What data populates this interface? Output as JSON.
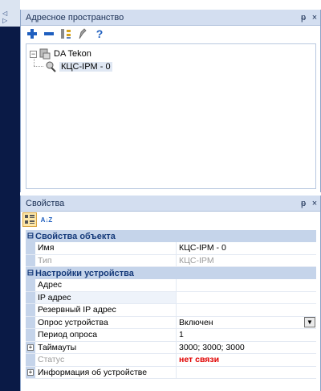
{
  "colors": {
    "accent": "#1f5fbf",
    "error": "#e00000"
  },
  "address_panel": {
    "title": "Адресное пространство",
    "pin": "ᵽ",
    "close": "×",
    "toolbar": {
      "add_icon": "plus-icon",
      "remove_icon": "minus-icon",
      "tool_icon": "settings-icon",
      "edit_icon": "pen-icon",
      "help_label": "?"
    },
    "tree": {
      "root_label": "DA Tekon",
      "child_label": "КЦС-IPM - 0"
    }
  },
  "properties_panel": {
    "title": "Свойства",
    "pin": "ᵽ",
    "close": "×",
    "sort_label": "A↓Z",
    "categories": [
      {
        "label": "Свойства объекта",
        "rows": [
          {
            "name": "Имя",
            "value": "КЦС-IPM - 0"
          },
          {
            "name": "Тип",
            "value": "КЦС-IPM"
          }
        ]
      },
      {
        "label": "Настройки устройства",
        "rows": [
          {
            "name": "Адрес",
            "value": ""
          },
          {
            "name": "IP адрес",
            "value": ""
          },
          {
            "name": "Резервный IP адрес",
            "value": ""
          },
          {
            "name": "Опрос устройства",
            "value": "Включен"
          },
          {
            "name": "Период опроса",
            "value": "1"
          },
          {
            "name": "Таймауты",
            "value": "3000; 3000; 3000"
          },
          {
            "name": "Статус",
            "value": "нет связи"
          },
          {
            "name": "Информация об устройстве",
            "value": ""
          }
        ]
      }
    ]
  },
  "nav_arrows": "◁ ▷"
}
